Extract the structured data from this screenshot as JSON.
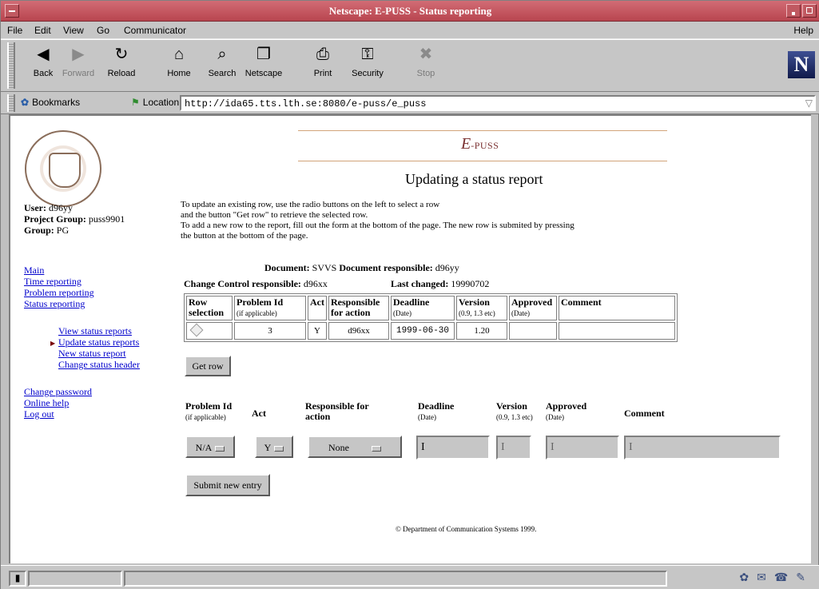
{
  "window": {
    "title": "Netscape: E-PUSS - Status reporting"
  },
  "menu": [
    "File",
    "Edit",
    "View",
    "Go",
    "Communicator"
  ],
  "help": "Help",
  "toolbar": [
    {
      "label": "Back",
      "icon": "back-arrow-icon",
      "glyph": "◀",
      "enabled": true
    },
    {
      "label": "Forward",
      "icon": "forward-arrow-icon",
      "glyph": "▶",
      "enabled": false
    },
    {
      "label": "Reload",
      "icon": "reload-icon",
      "glyph": "↻",
      "enabled": true
    },
    {
      "label": "Home",
      "icon": "home-icon",
      "glyph": "⌂",
      "enabled": true
    },
    {
      "label": "Search",
      "icon": "search-icon",
      "glyph": "⌕",
      "enabled": true
    },
    {
      "label": "Netscape",
      "icon": "netscape-icon",
      "glyph": "❐",
      "enabled": true
    },
    {
      "label": "Print",
      "icon": "print-icon",
      "glyph": "⎙",
      "enabled": true
    },
    {
      "label": "Security",
      "icon": "security-lock-icon",
      "glyph": "⚿",
      "enabled": true
    },
    {
      "label": "Stop",
      "icon": "stop-icon",
      "glyph": "✖",
      "enabled": false
    }
  ],
  "brand": "N",
  "location": {
    "bookmarks": "Bookmarks",
    "label": "Location:",
    "url": "http://ida65.tts.lth.se:8080/e-puss/e_puss"
  },
  "user": {
    "user_label": "User:",
    "user": "d96yy",
    "pg_label": "Project Group:",
    "pg": "puss9901",
    "group_label": "Group:",
    "group": "PG"
  },
  "nav": [
    "Main",
    "Time reporting",
    "Problem reporting",
    "Status reporting"
  ],
  "subnav": [
    "View status reports",
    "Update status reports",
    "New status report",
    "Change status header"
  ],
  "account": [
    "Change password",
    "Online help",
    "Log out"
  ],
  "logo": {
    "e": "E",
    "rest": "-PUSS"
  },
  "heading": "Updating a status report",
  "intro": [
    "To update an existing row, use the radio buttons on the left to select a row",
    "and the button \"Get row\" to retrieve the selected row.",
    "To add a new row to the report, fill out the form at the bottom of the page. The new row is submited by pressing",
    "the button at the bottom of the page."
  ],
  "doc": {
    "doc_label": "Document:",
    "doc": "SVVS",
    "resp_label": "Document responsible:",
    "resp": "d96yy",
    "cc_label": "Change Control responsible:",
    "cc": "d96xx",
    "lc_label": "Last changed:",
    "lc": "19990702"
  },
  "table": {
    "headers": [
      {
        "main": "Row selection",
        "sub": ""
      },
      {
        "main": "Problem Id",
        "sub": "(if applicable)"
      },
      {
        "main": "Act",
        "sub": ""
      },
      {
        "main": "Responsible for action",
        "sub": ""
      },
      {
        "main": "Deadline",
        "sub": "(Date)"
      },
      {
        "main": "Version",
        "sub": "(0.9, 1.3 etc)"
      },
      {
        "main": "Approved",
        "sub": "(Date)"
      },
      {
        "main": "Comment",
        "sub": ""
      }
    ],
    "rows": [
      {
        "problem": "3",
        "act": "Y",
        "resp": "d96xx",
        "deadline": "1999-06-30",
        "version": "1.20",
        "approved": "",
        "comment": ""
      }
    ]
  },
  "get_row": "Get row",
  "form": {
    "headers": [
      {
        "main": "Problem Id",
        "sub": "(if applicable)"
      },
      {
        "main": "Act",
        "sub": ""
      },
      {
        "main": "Responsible for action",
        "sub": ""
      },
      {
        "main": "Deadline",
        "sub": "(Date)"
      },
      {
        "main": "Version",
        "sub": "(0.9, 1.3 etc)"
      },
      {
        "main": "Approved",
        "sub": "(Date)"
      },
      {
        "main": "Comment",
        "sub": ""
      }
    ],
    "problem_value": "N/A",
    "act_value": "Y",
    "resp_value": "None",
    "deadline": "",
    "version": "",
    "approved": "",
    "comment": ""
  },
  "submit": "Submit new entry",
  "footer": "© Department of Communication Systems 1999."
}
